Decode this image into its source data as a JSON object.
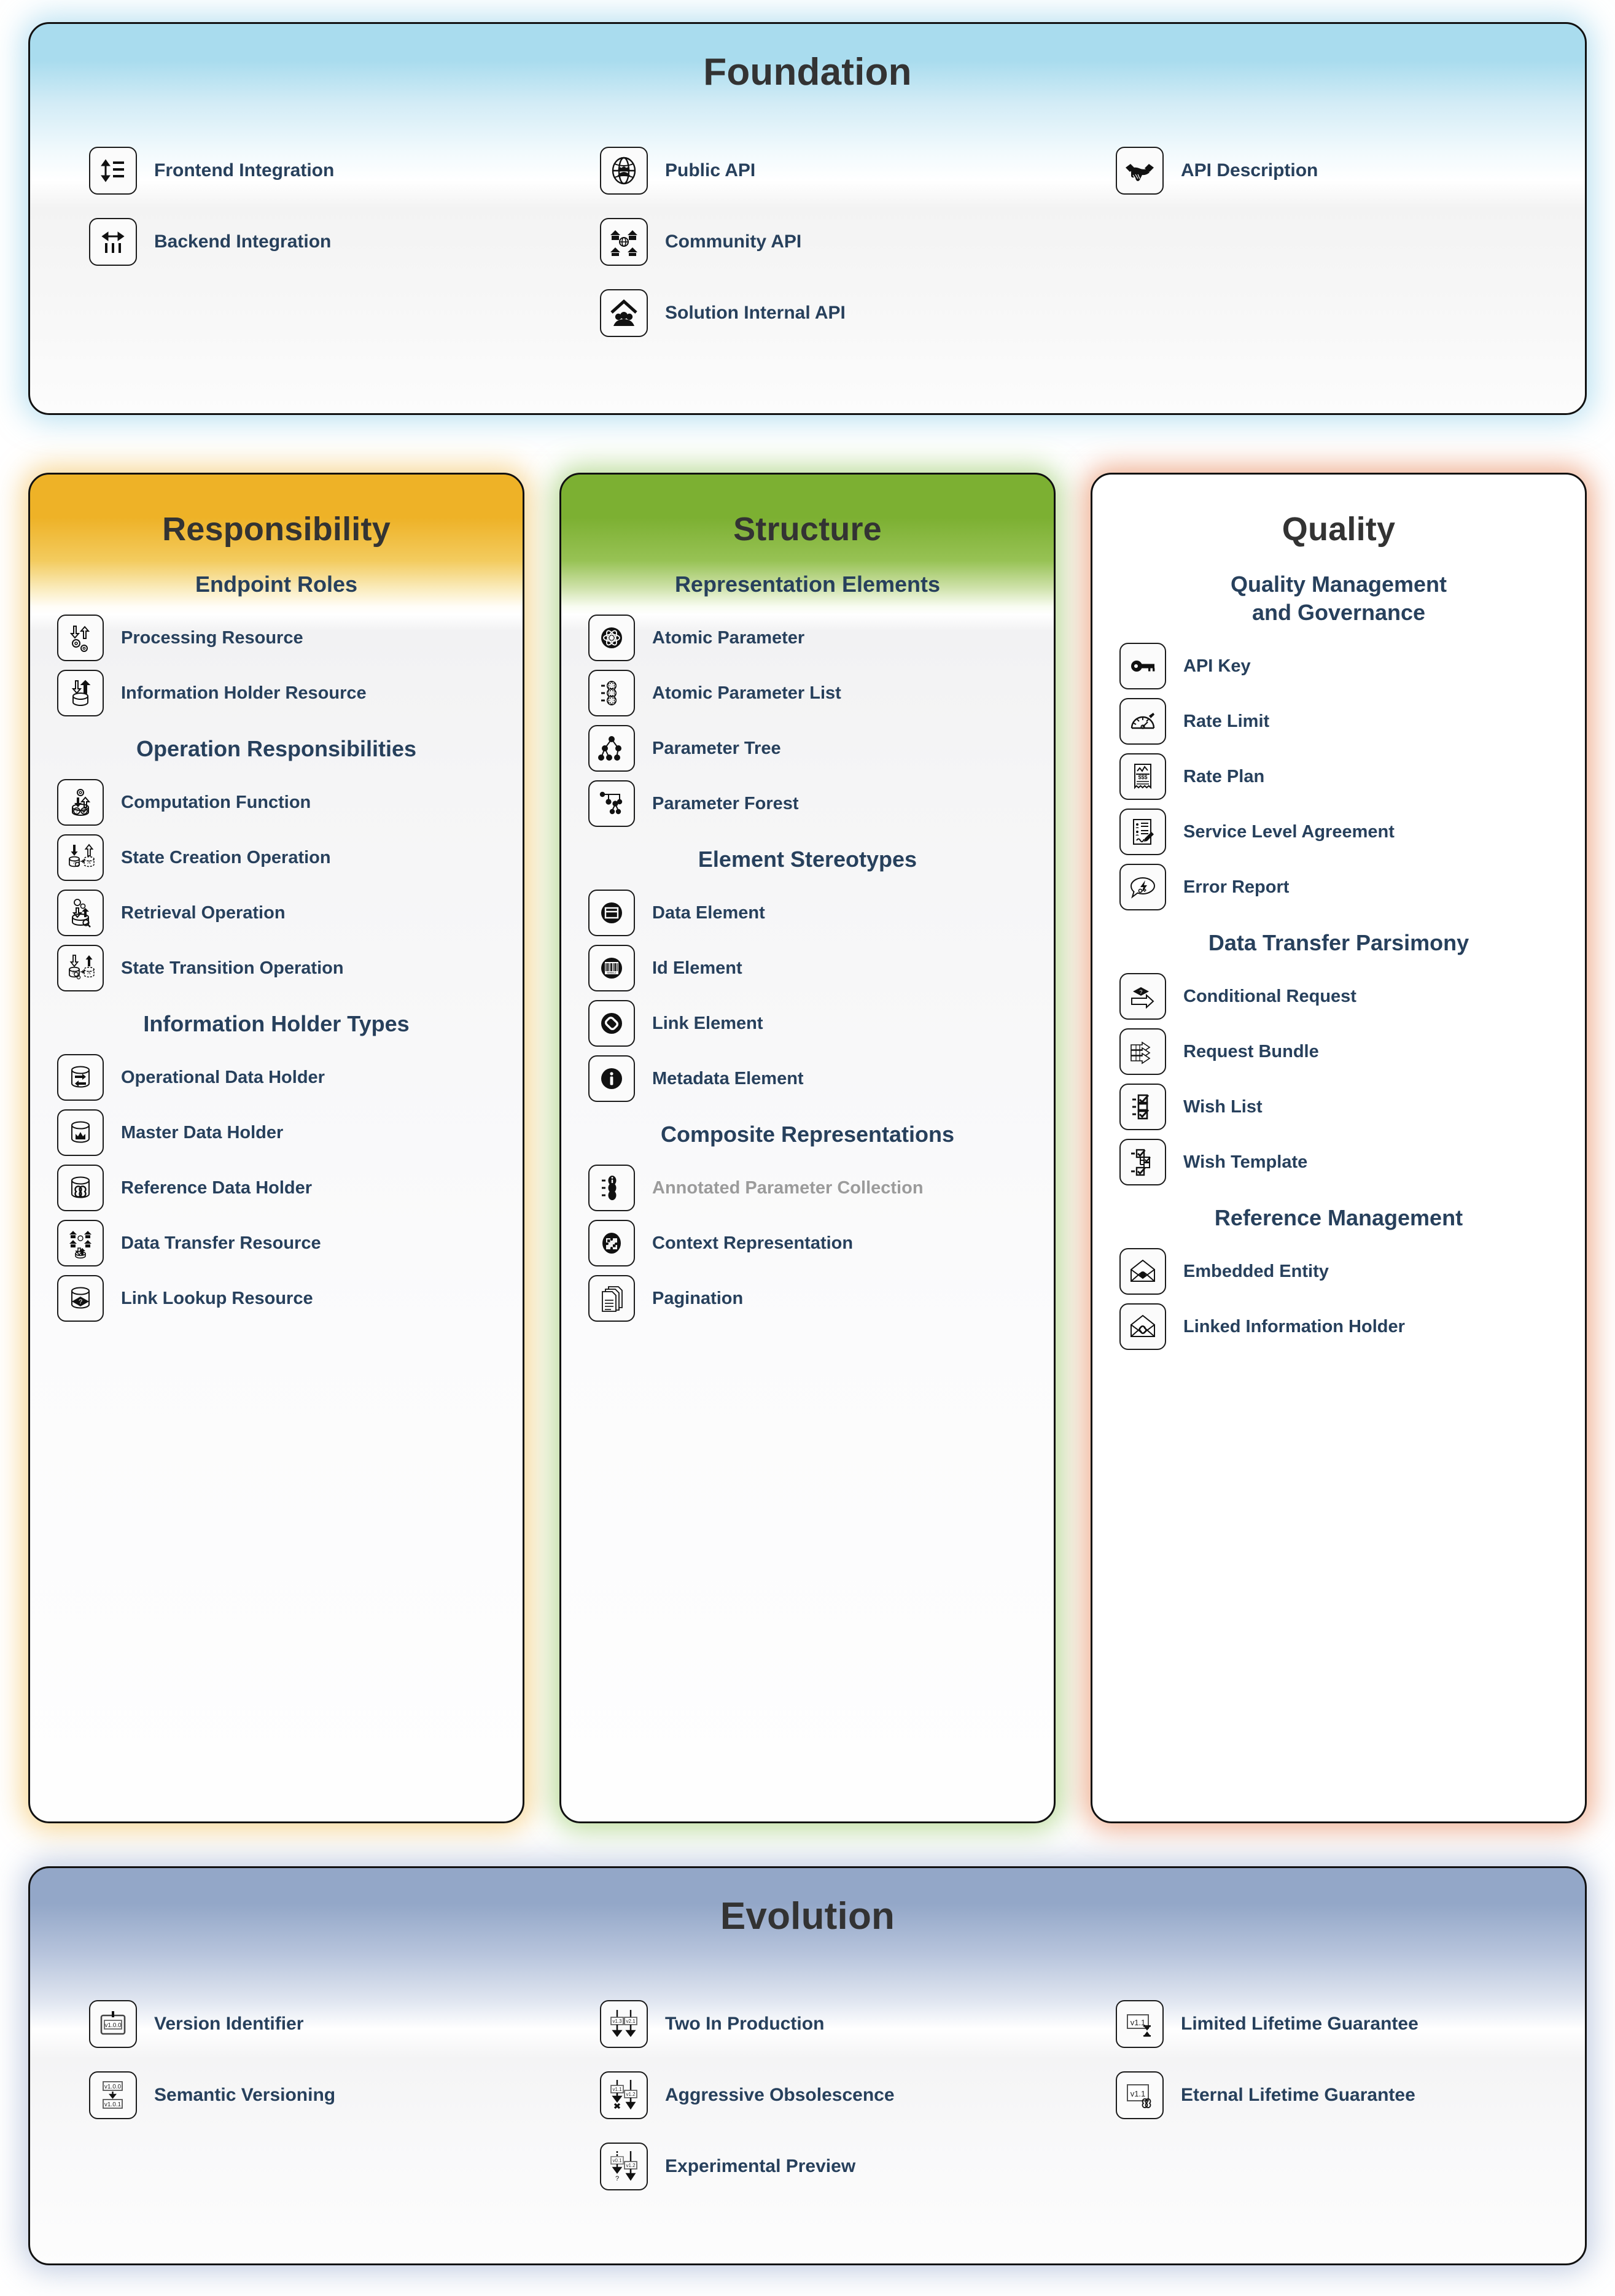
{
  "foundation": {
    "title": "Foundation",
    "columns": [
      {
        "items": [
          {
            "label": "Frontend Integration",
            "icon": "updown-arrow-lines-icon"
          },
          {
            "label": "Backend Integration",
            "icon": "leftright-arrow-bars-icon"
          }
        ]
      },
      {
        "items": [
          {
            "label": "Public API",
            "icon": "globe-people-icon"
          },
          {
            "label": "Community API",
            "icon": "houses-globe-icon"
          },
          {
            "label": "Solution Internal API",
            "icon": "house-people-icon"
          }
        ]
      },
      {
        "items": [
          {
            "label": "API Description",
            "icon": "handshake-icon"
          }
        ]
      }
    ]
  },
  "pillars": [
    {
      "id": "responsibility",
      "title": "Responsibility",
      "accent": "#eeb227",
      "groups": [
        {
          "heading": "Endpoint Roles",
          "items": [
            {
              "label": "Processing Resource",
              "icon": "arrows-gears-icon"
            },
            {
              "label": "Information Holder Resource",
              "icon": "db-arrows-icon"
            }
          ]
        },
        {
          "heading": "Operation Responsibilities",
          "items": [
            {
              "label": "Computation Function",
              "icon": "gear-db-question-icon"
            },
            {
              "label": "State Creation Operation",
              "icon": "db-to-db-create-icon"
            },
            {
              "label": "Retrieval Operation",
              "icon": "db-search-icon"
            },
            {
              "label": "State Transition Operation",
              "icon": "db-to-db-transition-icon"
            }
          ]
        },
        {
          "heading": "Information Holder Types",
          "items": [
            {
              "label": "Operational Data Holder",
              "icon": "db-exchange-icon"
            },
            {
              "label": "Master Data Holder",
              "icon": "db-crown-icon"
            },
            {
              "label": "Reference Data Holder",
              "icon": "db-infinity-icon"
            },
            {
              "label": "Data Transfer Resource",
              "icon": "houses-db-icon"
            },
            {
              "label": "Link Lookup Resource",
              "icon": "db-diamond-icon"
            }
          ]
        }
      ]
    },
    {
      "id": "structure",
      "title": "Structure",
      "accent": "#7cb032",
      "groups": [
        {
          "heading": "Representation Elements",
          "items": [
            {
              "label": "Atomic Parameter",
              "icon": "atom-icon"
            },
            {
              "label": "Atomic Parameter List",
              "icon": "atom-list-icon"
            },
            {
              "label": "Parameter Tree",
              "icon": "tree-icon"
            },
            {
              "label": "Parameter Forest",
              "icon": "forest-icon"
            }
          ]
        },
        {
          "heading": "Element Stereotypes",
          "items": [
            {
              "label": "Data Element",
              "icon": "data-card-icon"
            },
            {
              "label": "Id Element",
              "icon": "barcode-icon"
            },
            {
              "label": "Link Element",
              "icon": "chain-link-icon"
            },
            {
              "label": "Metadata Element",
              "icon": "info-icon"
            }
          ]
        },
        {
          "heading": "Composite Representations",
          "items": [
            {
              "label": "Annotated Parameter Collection",
              "icon": "annotated-list-icon",
              "muted": true
            },
            {
              "label": "Context Representation",
              "icon": "puzzle-icon"
            },
            {
              "label": "Pagination",
              "icon": "pages-icon"
            }
          ]
        }
      ]
    },
    {
      "id": "quality",
      "title": "Quality",
      "accent": "#df5a1c",
      "groups": [
        {
          "heading": "Quality Management\nand Governance",
          "items": [
            {
              "label": "API Key",
              "icon": "key-icon"
            },
            {
              "label": "Rate Limit",
              "icon": "gauge-icon"
            },
            {
              "label": "Rate Plan",
              "icon": "receipt-dollar-icon"
            },
            {
              "label": "Service Level Agreement",
              "icon": "contract-pen-icon"
            },
            {
              "label": "Error Report",
              "icon": "speech-bolt-icon"
            }
          ]
        },
        {
          "heading": "Data Transfer Parsimony",
          "items": [
            {
              "label": "Conditional Request",
              "icon": "arrow-diamond-icon"
            },
            {
              "label": "Request Bundle",
              "icon": "stacked-arrows-icon"
            },
            {
              "label": "Wish List",
              "icon": "checklist-icon"
            },
            {
              "label": "Wish Template",
              "icon": "nested-checklist-icon"
            }
          ]
        },
        {
          "heading": "Reference Management",
          "items": [
            {
              "label": "Embedded Entity",
              "icon": "envelope-dot-icon"
            },
            {
              "label": "Linked Information Holder",
              "icon": "envelope-link-icon"
            }
          ]
        }
      ]
    }
  ],
  "evolution": {
    "title": "Evolution",
    "columns": [
      {
        "items": [
          {
            "label": "Version Identifier",
            "icon": "version-tag-icon",
            "versions": [
              "v1.0.0"
            ]
          },
          {
            "label": "Semantic Versioning",
            "icon": "semver-icon",
            "versions": [
              "v1.0.0",
              "v1.0.1"
            ]
          }
        ]
      },
      {
        "items": [
          {
            "label": "Two In Production",
            "icon": "two-versions-icon",
            "versions": [
              "v1.3",
              "v2.1"
            ]
          },
          {
            "label": "Aggressive Obsolescence",
            "icon": "obsolescence-icon",
            "versions": [
              "v1.1",
              "v1.2"
            ]
          },
          {
            "label": "Experimental Preview",
            "icon": "experimental-icon",
            "versions": [
              "v0.1",
              "v1.2"
            ]
          }
        ]
      },
      {
        "items": [
          {
            "label": "Limited Lifetime Guarantee",
            "icon": "hourglass-version-icon",
            "versions": [
              "v1.1"
            ]
          },
          {
            "label": "Eternal Lifetime Guarantee",
            "icon": "infinity-version-icon",
            "versions": [
              "v1.1"
            ]
          }
        ]
      }
    ]
  }
}
